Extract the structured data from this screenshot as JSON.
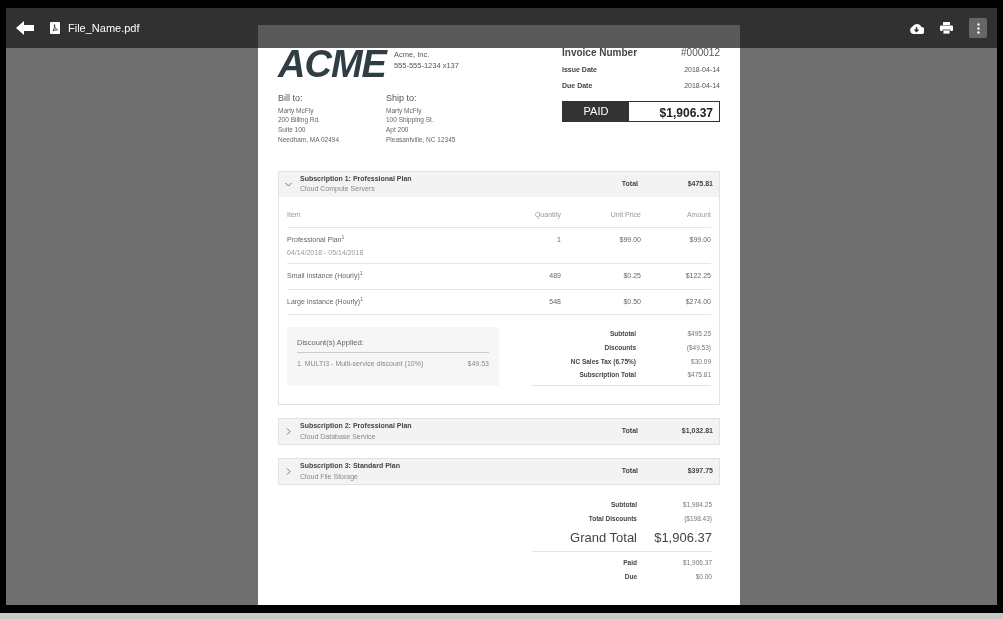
{
  "toolbar": {
    "file_name": "File_Name.pdf"
  },
  "header": {
    "logo": "ACME",
    "company": "Acme, Inc.",
    "phone": "555-555-1234 x137",
    "meta": [
      {
        "label": "Invoice Number",
        "value": "#000012",
        "kind": "large"
      },
      {
        "label": "Issue Date",
        "value": "2018-04-14",
        "kind": "small"
      },
      {
        "label": "Due Date",
        "value": "2018-04-14",
        "kind": "small"
      }
    ],
    "status": {
      "label": "PAID",
      "amount": "$1,906.37"
    }
  },
  "addresses": [
    {
      "heading": "Bill to:",
      "lines": [
        "Marty McFly",
        "200 Billing Rd.",
        "Suite 100",
        "Needham, MA 02494"
      ]
    },
    {
      "heading": "Ship to:",
      "lines": [
        "Marty McFly",
        "100 Shipping St.",
        "Apt 200",
        "Pleasantville, NC 12345"
      ]
    }
  ],
  "subscriptions": [
    {
      "title": "Subscription 1: Professional Plan",
      "subtitle": "Cloud Compute Servers",
      "total_label": "Total",
      "total": "$475.81",
      "expanded": true,
      "columns": [
        "Item",
        "Quantity",
        "Unit Price",
        "Amount"
      ],
      "items": [
        {
          "name": "Professional Plan$^{1}$",
          "dates": "04/14/2018 - 05/14/2018",
          "quantity": "1",
          "unit_price": "$99.00",
          "amount": "$99.00"
        },
        {
          "name": "Small Instance (Hourly)$^{1}$",
          "quantity": "489",
          "unit_price": "$0.25",
          "amount": "$122.25"
        },
        {
          "name": "Large Instance (Hourly)$^{1}$",
          "quantity": "548",
          "unit_price": "$0.50",
          "amount": "$274.00"
        }
      ],
      "discounts": {
        "heading": "Discount(s) Applied:",
        "items": [
          {
            "text": "1. MULTI3 - Multi-service discount (10%)",
            "amount": "$49.53"
          }
        ]
      },
      "totals": [
        {
          "label": "Subtotal",
          "value": "$495.25"
        },
        {
          "label": "Discounts",
          "value": "($49.53)"
        },
        {
          "label": "NC Sales Tax (6.75%)",
          "value": "$30.09"
        },
        {
          "label": "Subscription Total",
          "value": "$475.81"
        }
      ]
    },
    {
      "title": "Subscription 2: Professional Plan",
      "subtitle": "Cloud Database Service",
      "total_label": "Total",
      "total": "$1,032.81",
      "expanded": false
    },
    {
      "title": "Subscription 3: Standard Plan",
      "subtitle": "Cloud File Storage",
      "total_label": "Total",
      "total": "$397.75",
      "expanded": false
    }
  ],
  "summary": [
    {
      "label": "Subtotal",
      "value": "$1,984.25",
      "kind": "normal"
    },
    {
      "label": "Total Discounts",
      "value": "($198.43)",
      "kind": "normal"
    },
    {
      "label": "Grand Total",
      "value": "$1,906.37",
      "kind": "grand"
    },
    {
      "label": "Paid",
      "value": "$1,906.37",
      "kind": "normal"
    },
    {
      "label": "Due",
      "value": "$0.00",
      "kind": "normal"
    }
  ]
}
